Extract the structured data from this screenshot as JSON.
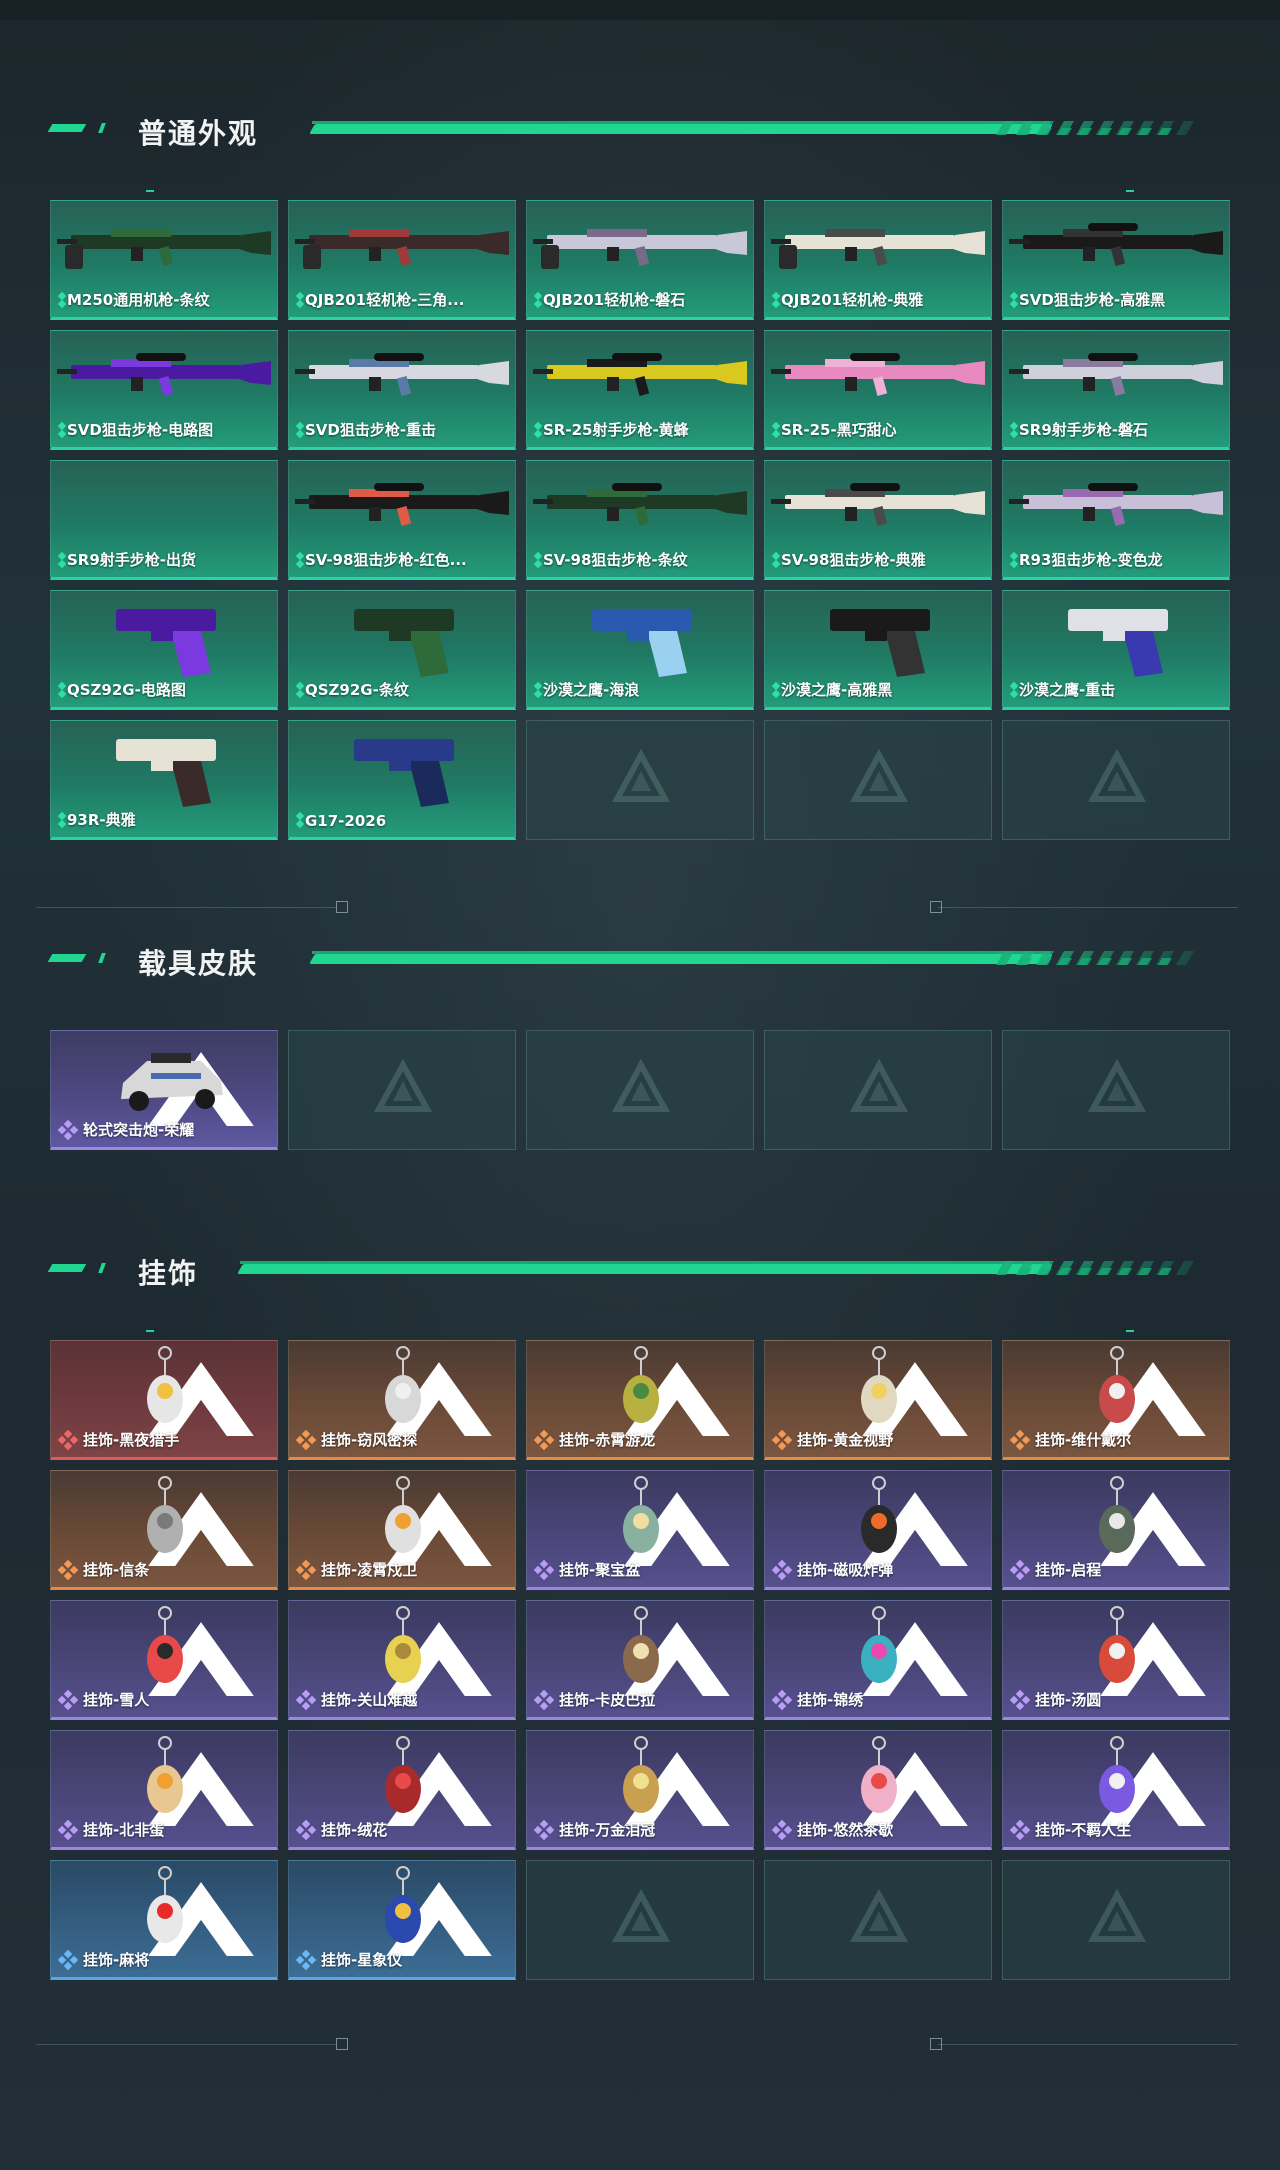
{
  "sections": [
    {
      "title": "普通外观"
    },
    {
      "title": "载具皮肤"
    },
    {
      "title": "挂饰"
    }
  ],
  "colors": {
    "accent": "#21d690",
    "empty": "#2a4849"
  },
  "weapons": [
    {
      "label": "M250通用机枪-条纹",
      "rarity": "green"
    },
    {
      "label": "QJB201轻机枪-三角...",
      "rarity": "green"
    },
    {
      "label": "QJB201轻机枪-磐石",
      "rarity": "green"
    },
    {
      "label": "QJB201轻机枪-典雅",
      "rarity": "green"
    },
    {
      "label": "SVD狙击步枪-高雅黑",
      "rarity": "green"
    },
    {
      "label": "SVD狙击步枪-电路图",
      "rarity": "green"
    },
    {
      "label": "SVD狙击步枪-重击",
      "rarity": "green"
    },
    {
      "label": "SR-25射手步枪-黄蜂",
      "rarity": "green"
    },
    {
      "label": "SR-25-黑巧甜心",
      "rarity": "green"
    },
    {
      "label": "SR9射手步枪-磐石",
      "rarity": "green"
    },
    {
      "label": "SR9射手步枪-出货",
      "rarity": "green"
    },
    {
      "label": "SV-98狙击步枪-红色...",
      "rarity": "green"
    },
    {
      "label": "SV-98狙击步枪-条纹",
      "rarity": "green"
    },
    {
      "label": "SV-98狙击步枪-典雅",
      "rarity": "green"
    },
    {
      "label": "R93狙击步枪-变色龙",
      "rarity": "green"
    },
    {
      "label": "QSZ92G-电路图",
      "rarity": "green"
    },
    {
      "label": "QSZ92G-条纹",
      "rarity": "green"
    },
    {
      "label": "沙漠之鹰-海浪",
      "rarity": "green"
    },
    {
      "label": "沙漠之鹰-高雅黑",
      "rarity": "green"
    },
    {
      "label": "沙漠之鹰-重击",
      "rarity": "green"
    },
    {
      "label": "93R-典雅",
      "rarity": "green"
    },
    {
      "label": "G17-2026",
      "rarity": "green"
    }
  ],
  "vehicles": [
    {
      "label": "轮式突击炮-荣耀",
      "rarity": "vehicle"
    }
  ],
  "charms": [
    {
      "label": "挂饰-黑夜猎手",
      "rarity": "red"
    },
    {
      "label": "挂饰-窃风密探",
      "rarity": "orange"
    },
    {
      "label": "挂饰-赤霄游龙",
      "rarity": "orange"
    },
    {
      "label": "挂饰-黄金视野",
      "rarity": "orange"
    },
    {
      "label": "挂饰-维什戴尔",
      "rarity": "orange"
    },
    {
      "label": "挂饰-信条",
      "rarity": "orange"
    },
    {
      "label": "挂饰-凌霄戍卫",
      "rarity": "orange"
    },
    {
      "label": "挂饰-聚宝盆",
      "rarity": "purple"
    },
    {
      "label": "挂饰-磁吸炸弹",
      "rarity": "purple"
    },
    {
      "label": "挂饰-启程",
      "rarity": "purple"
    },
    {
      "label": "挂饰-雪人",
      "rarity": "purple"
    },
    {
      "label": "挂饰-关山难越",
      "rarity": "purple"
    },
    {
      "label": "挂饰-卡皮巴拉",
      "rarity": "purple"
    },
    {
      "label": "挂饰-锦绣",
      "rarity": "purple"
    },
    {
      "label": "挂饰-汤圆",
      "rarity": "purple"
    },
    {
      "label": "挂饰-北非蛋",
      "rarity": "purple"
    },
    {
      "label": "挂饰-绒花",
      "rarity": "purple"
    },
    {
      "label": "挂饰-万金泪冠",
      "rarity": "purple"
    },
    {
      "label": "挂饰-悠然茶歇",
      "rarity": "purple"
    },
    {
      "label": "挂饰-不羁人生",
      "rarity": "purple"
    },
    {
      "label": "挂饰-麻将",
      "rarity": "blue"
    },
    {
      "label": "挂饰-星象仪",
      "rarity": "blue"
    }
  ]
}
